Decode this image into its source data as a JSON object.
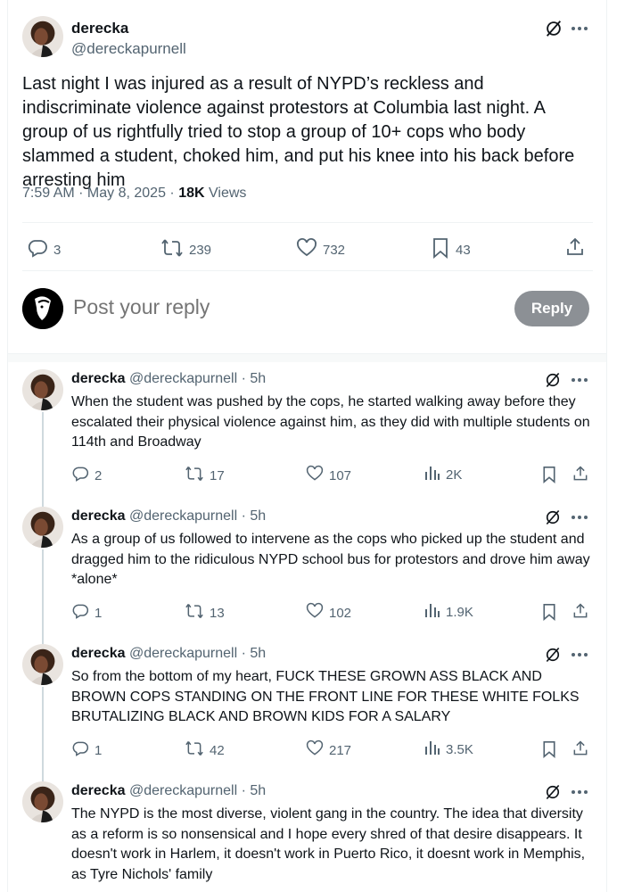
{
  "main_tweet": {
    "display_name": "derecka",
    "handle": "@dereckapurnell",
    "text": "Last night I was injured as a result of NYPD’s reckless and indiscriminate violence against protestors at Columbia last night. A group of us rightfully tried to stop a group of 10+ cops who body slammed a student, choked him, and put his knee into his back before arresting him",
    "time": "7:59 AM · May 8, 2025 · ",
    "views_count": "18K",
    "views_label": " Views",
    "replies": "3",
    "reposts": "239",
    "likes": "732",
    "bookmarks": "43"
  },
  "composer": {
    "placeholder": "Post your reply",
    "button_label": "Reply"
  },
  "thread": [
    {
      "display_name": "derecka",
      "handle": "@dereckapurnell · 5h",
      "text": "When the student was pushed by the cops, he started walking away before they escalated their physical violence against him, as they did with multiple students on 114th and Broadway",
      "replies": "2",
      "reposts": "17",
      "likes": "107",
      "views": "2K"
    },
    {
      "display_name": "derecka",
      "handle": "@dereckapurnell · 5h",
      "text": "As a group of us followed to intervene as the cops who picked up the student and dragged him to the ridiculous NYPD school bus for protestors and drove him away *alone*",
      "replies": "1",
      "reposts": "13",
      "likes": "102",
      "views": "1.9K"
    },
    {
      "display_name": "derecka",
      "handle": "@dereckapurnell · 5h",
      "text": "So from the bottom of my heart, FUCK THESE GROWN ASS BLACK AND BROWN COPS STANDING ON THE FRONT LINE FOR THESE WHITE FOLKS BRUTALIZING BLACK AND BROWN KIDS FOR A SALARY",
      "replies": "1",
      "reposts": "42",
      "likes": "217",
      "views": "3.5K"
    },
    {
      "display_name": "derecka",
      "handle": "@dereckapurnell · 5h",
      "text": "The NYPD is the most diverse, violent gang in the country. The idea that diversity as a reform is so nonsensical and I hope every shred of that desire disappears. It doesn't work in Harlem, it doesn't work in Puerto Rico, it doesnt work in Memphis, as Tyre Nichols' family"
    }
  ],
  "icons": [
    "grok-icon",
    "more-icon",
    "reply-icon",
    "repost-icon",
    "like-icon",
    "bookmark-icon",
    "share-icon",
    "views-icon"
  ],
  "colors": {
    "text": "#0f1419",
    "muted": "#536471",
    "border": "#eff3f4",
    "reply_button": "#8c9095"
  }
}
